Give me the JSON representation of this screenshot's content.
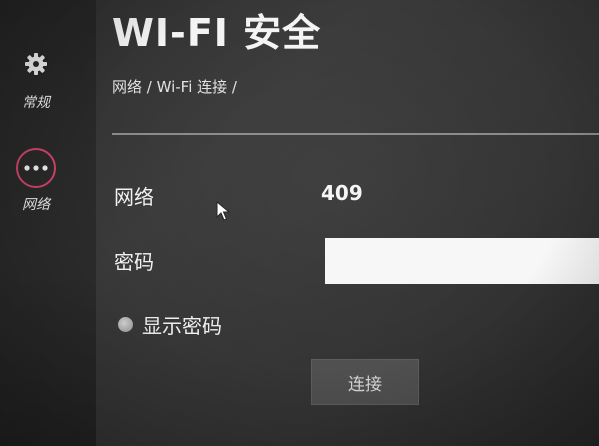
{
  "header": {
    "title": "WI-FI 安全",
    "breadcrumb": "网络 / Wi-Fi 连接 /"
  },
  "sidebar": {
    "items": [
      {
        "label": "常规",
        "icon": "gear-icon",
        "selected": false
      },
      {
        "label": "网络",
        "icon": "more-dots-icon",
        "selected": true
      }
    ]
  },
  "form": {
    "network_label": "网络",
    "network_value": "409",
    "password_label": "密码",
    "password_value": "",
    "show_password_label": "显示密码",
    "connect_label": "连接"
  },
  "colors": {
    "accent": "#d2456b",
    "background": "#333333",
    "input_background": "#f7f7f7",
    "button_background": "#505050"
  }
}
